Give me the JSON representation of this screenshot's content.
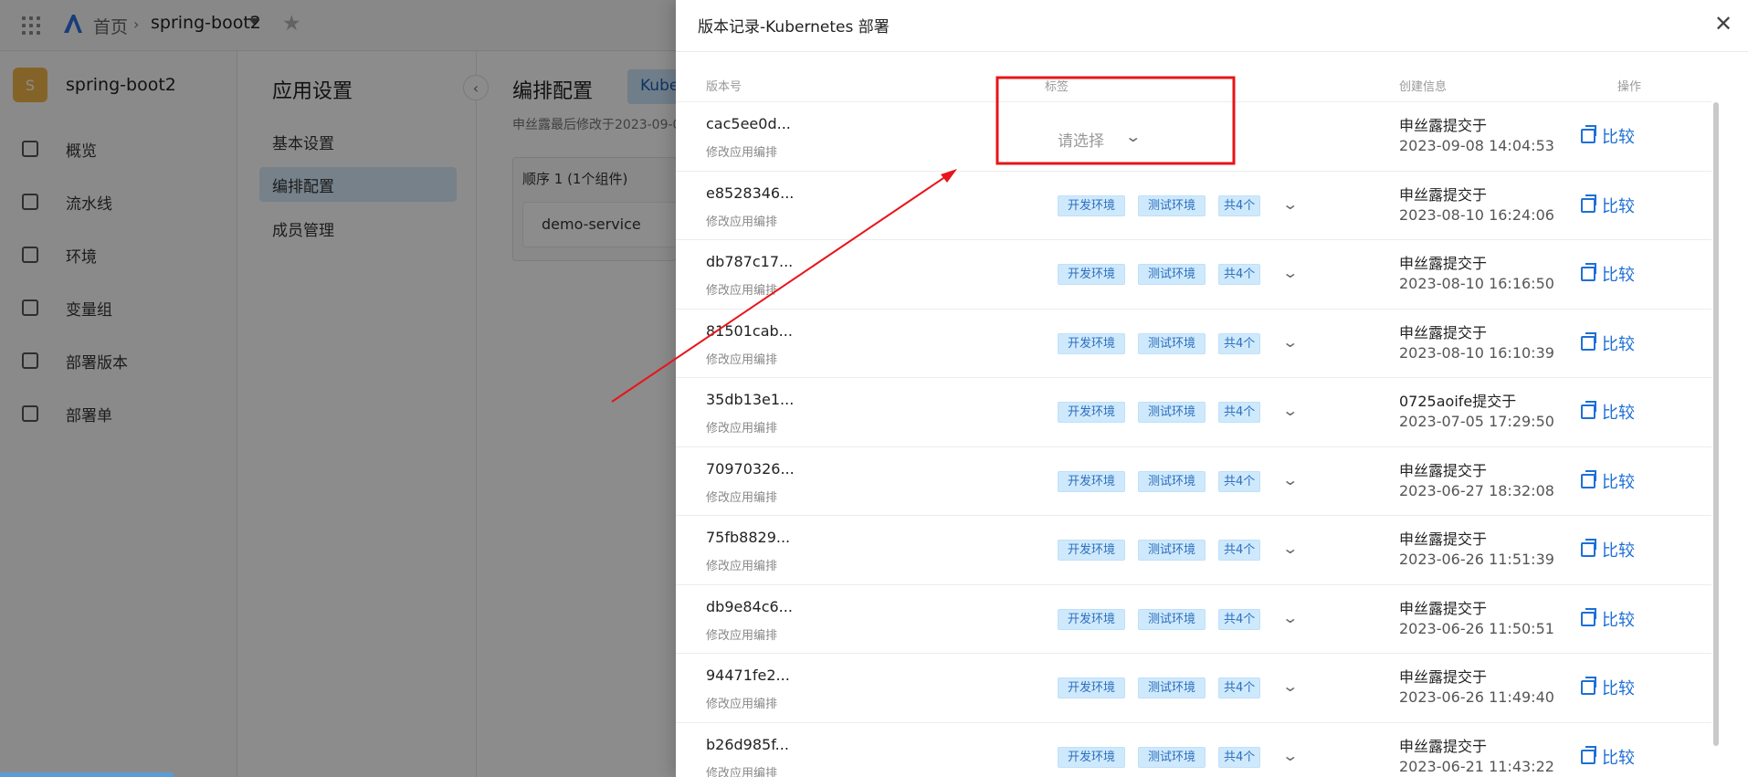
{
  "topbar": {
    "home": "首页",
    "app_name": "spring-boot2"
  },
  "sidebar": {
    "avatar_letter": "S",
    "project_name": "spring-boot2",
    "items": [
      {
        "label": "概览",
        "icon": "chart-line-icon"
      },
      {
        "label": "流水线",
        "icon": "pipeline-icon"
      },
      {
        "label": "环境",
        "icon": "grid-icon"
      },
      {
        "label": "变量组",
        "icon": "variable-icon"
      },
      {
        "label": "部署版本",
        "icon": "stack-icon"
      },
      {
        "label": "部署单",
        "icon": "list-doc-icon"
      }
    ]
  },
  "settings": {
    "title": "应用设置",
    "items": [
      "基本设置",
      "编排配置",
      "成员管理"
    ],
    "active_index": 1
  },
  "main": {
    "title": "编排配置",
    "tab": "Kube",
    "subtitle": "申丝露最后修改于2023-09-0",
    "order_title": "顺序 1 (1个组件)",
    "service": "demo-service"
  },
  "drawer": {
    "title": "版本记录-Kubernetes 部署",
    "columns": {
      "version": "版本号",
      "tags": "标签",
      "created": "创建信息",
      "action": "操作"
    },
    "select_placeholder": "请选择",
    "tag_labels": [
      "开发环境",
      "测试环境"
    ],
    "tag_count": "共4个",
    "compare_label": "比较",
    "rows": [
      {
        "version": "cac5ee0d...",
        "desc": "修改应用编排",
        "submitter": "申丝露提交于",
        "time": "2023-09-08 14:04:53"
      },
      {
        "version": "e8528346...",
        "desc": "修改应用编排",
        "submitter": "申丝露提交于",
        "time": "2023-08-10 16:24:06"
      },
      {
        "version": "db787c17...",
        "desc": "修改应用编排",
        "submitter": "申丝露提交于",
        "time": "2023-08-10 16:16:50"
      },
      {
        "version": "81501cab...",
        "desc": "修改应用编排",
        "submitter": "申丝露提交于",
        "time": "2023-08-10 16:10:39"
      },
      {
        "version": "35db13e1...",
        "desc": "修改应用编排",
        "submitter": "0725aoife提交于",
        "time": "2023-07-05 17:29:50"
      },
      {
        "version": "70970326...",
        "desc": "修改应用编排",
        "submitter": "申丝露提交于",
        "time": "2023-06-27 18:32:08"
      },
      {
        "version": "75fb8829...",
        "desc": "修改应用编排",
        "submitter": "申丝露提交于",
        "time": "2023-06-26 11:51:39"
      },
      {
        "version": "db9e84c6...",
        "desc": "修改应用编排",
        "submitter": "申丝露提交于",
        "time": "2023-06-26 11:50:51"
      },
      {
        "version": "94471fe2...",
        "desc": "修改应用编排",
        "submitter": "申丝露提交于",
        "time": "2023-06-26 11:49:40"
      },
      {
        "version": "b26d985f...",
        "desc": "修改应用编排",
        "submitter": "申丝露提交于",
        "time": "2023-06-21 11:43:22"
      }
    ]
  },
  "annotation_color": "#e8141a"
}
